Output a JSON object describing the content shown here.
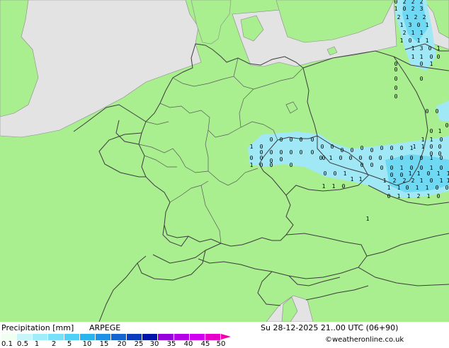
{
  "legend": {
    "title": "Precipitation [mm]",
    "model": "ARPEGE",
    "datetime": "Su 28-12-2025 21..00 UTC (06+90)",
    "credit": "©weatheronline.co.uk",
    "ticks": [
      "0.1",
      "0.5",
      "1",
      "2",
      "5",
      "10",
      "15",
      "20",
      "25",
      "30",
      "35",
      "40",
      "45",
      "50"
    ],
    "colors": [
      "#f0fff0",
      "#c8f5fa",
      "#a0ecf8",
      "#78e0f8",
      "#50d0f5",
      "#2ab4ee",
      "#1e90e6",
      "#1464d2",
      "#0a3cbe",
      "#0014aa",
      "#9600dc",
      "#b400e6",
      "#d200f0",
      "#e600c8",
      "#f000aa"
    ]
  },
  "map": {
    "colors": {
      "land": "#a9ee8f",
      "sea": "#e3e3e3",
      "border": "#3c3c3c",
      "coast": "#8a8a8a",
      "precip_light": "#a0e8f5",
      "precip_mod": "#6fd8f2"
    },
    "values": {
      "baltic": [
        "0",
        "2",
        "2",
        "2",
        "1",
        "0",
        "2",
        "3",
        "2",
        "1",
        "2",
        "2",
        "1",
        "3",
        "0",
        "1",
        "2",
        "1",
        "1",
        "1",
        "0",
        "1",
        "1",
        "1",
        "3",
        "0",
        "1",
        "1",
        "1",
        "0",
        "0",
        "0",
        "0",
        "1"
      ],
      "poland_coast": [
        "0",
        "0",
        "0",
        "0",
        "0",
        "0",
        "0",
        "1",
        "1",
        "1",
        "0",
        "1",
        "1",
        "0",
        "0",
        "0",
        "0"
      ],
      "bohemia": [
        "1",
        "0",
        "0",
        "0",
        "0",
        "0",
        "0",
        "0",
        "0",
        "0",
        "0",
        "0",
        "0",
        "0",
        "0",
        "0",
        "0",
        "0",
        "0",
        "0",
        "0",
        "0",
        "0",
        "0",
        "0",
        "1",
        "0",
        "1",
        "0",
        "0",
        "0",
        "0",
        "0"
      ],
      "south_poland": [
        "0",
        "0",
        "1",
        "0",
        "0",
        "0",
        "0",
        "0",
        "0",
        "1",
        "0",
        "0",
        "0",
        "0",
        "0",
        "1",
        "0",
        "0",
        "1",
        "0",
        "0",
        "0",
        "1",
        "0",
        "0",
        "1",
        "1",
        "0",
        "1",
        "1",
        "1",
        "1",
        "1",
        "2",
        "2",
        "2",
        "1",
        "0",
        "1",
        "1",
        "1",
        "1",
        "0",
        "1",
        "1",
        "0",
        "1",
        "1",
        "0",
        "0",
        "0",
        "1",
        "1",
        "2",
        "1",
        "0"
      ],
      "isolated": [
        "1",
        "0",
        "0",
        "0"
      ]
    }
  }
}
